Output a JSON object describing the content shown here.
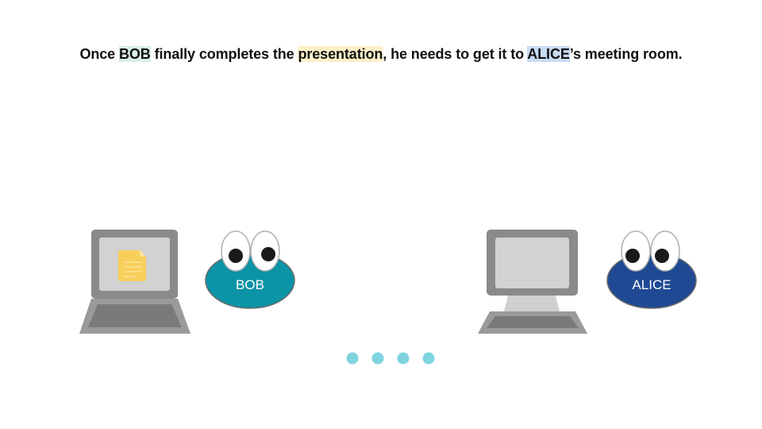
{
  "caption": {
    "part1": "Once ",
    "bob": "BOB",
    "part2": " finally completes the ",
    "presentation": "presentation",
    "part3": ", he needs to get it to ",
    "alice": "ALICE",
    "part4": "’s meeting room."
  },
  "characters": {
    "bob": {
      "label": "BOB",
      "color": "#0b93a6"
    },
    "alice": {
      "label": "ALICE",
      "color": "#1f4a93"
    }
  },
  "progress_dots": {
    "count": 4,
    "color": "#7fd4e0"
  },
  "document_color": "#f7cf5a"
}
